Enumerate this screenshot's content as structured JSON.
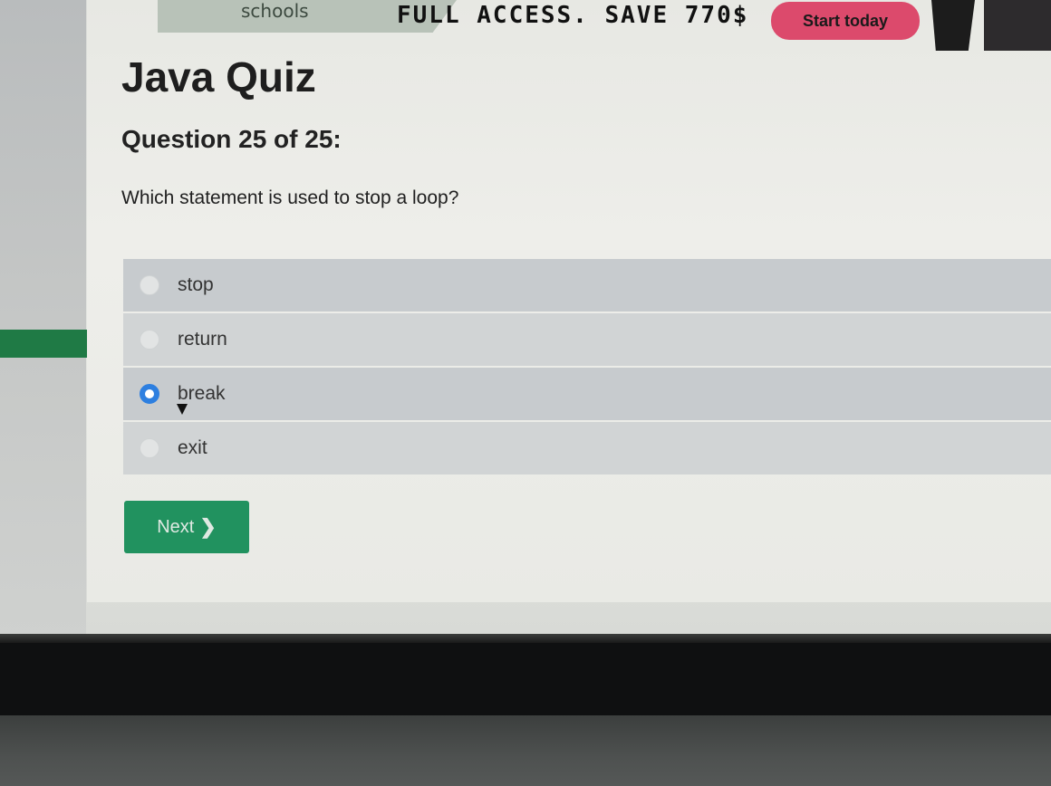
{
  "topbar": {
    "brand_label": "schools",
    "promo_text": "FULL ACCESS. SAVE 770$",
    "cta_label": "Start today",
    "cta_color": "#dc4a6c"
  },
  "quiz": {
    "title": "Java Quiz",
    "progress": "Question 25 of 25:",
    "question": "Which statement is used to stop a loop?",
    "options": [
      {
        "label": "stop",
        "selected": false
      },
      {
        "label": "return",
        "selected": false
      },
      {
        "label": "break",
        "selected": true
      },
      {
        "label": "exit",
        "selected": false
      }
    ],
    "next_label": "Next",
    "next_icon": "chevron-right-icon",
    "accent_color": "#21925f",
    "radio_color": "#2d7fe0"
  }
}
